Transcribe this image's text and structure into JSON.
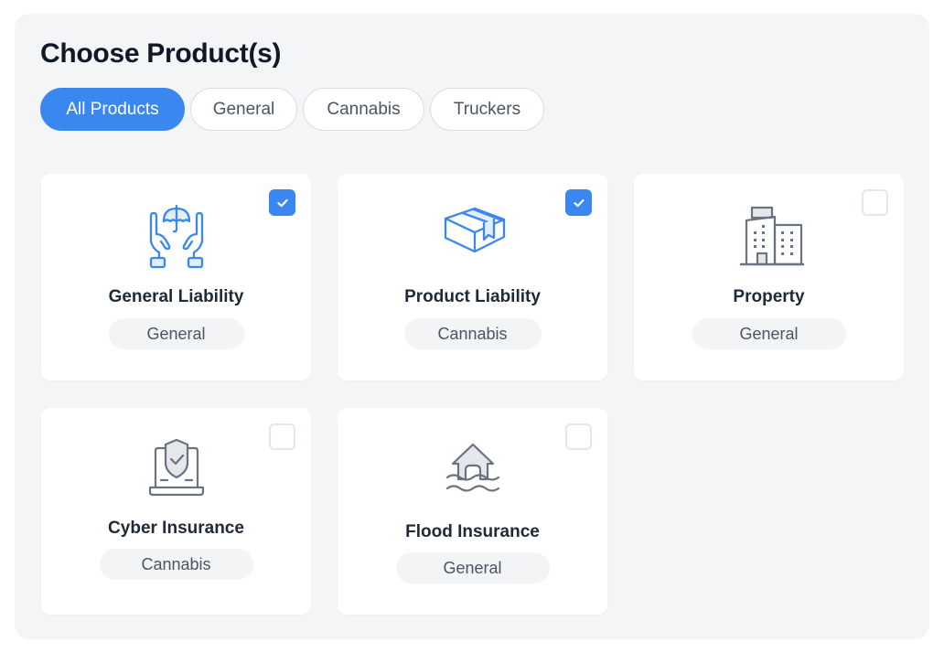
{
  "header": {
    "title": "Choose Product(s)"
  },
  "filters": [
    {
      "label": "All Products",
      "active": true
    },
    {
      "label": "General",
      "active": false
    },
    {
      "label": "Cannabis",
      "active": false
    },
    {
      "label": "Truckers",
      "active": false
    }
  ],
  "colors": {
    "accent": "#3b87f0",
    "icon_gray": "#6b7280",
    "icon_fill_blue": "#e3eefc",
    "icon_fill_gray": "#e5e7eb"
  },
  "products": [
    {
      "name": "General Liability",
      "category": "General",
      "checked": true,
      "icon": "hands-umbrella-icon"
    },
    {
      "name": "Product Liability",
      "category": "Cannabis",
      "checked": true,
      "icon": "package-box-icon"
    },
    {
      "name": "Property",
      "category": "General",
      "checked": false,
      "icon": "buildings-icon"
    },
    {
      "name": "Cyber Insurance",
      "category": "Cannabis",
      "checked": false,
      "icon": "laptop-shield-icon"
    },
    {
      "name": "Flood Insurance",
      "category": "General",
      "checked": false,
      "icon": "house-flood-icon"
    }
  ]
}
